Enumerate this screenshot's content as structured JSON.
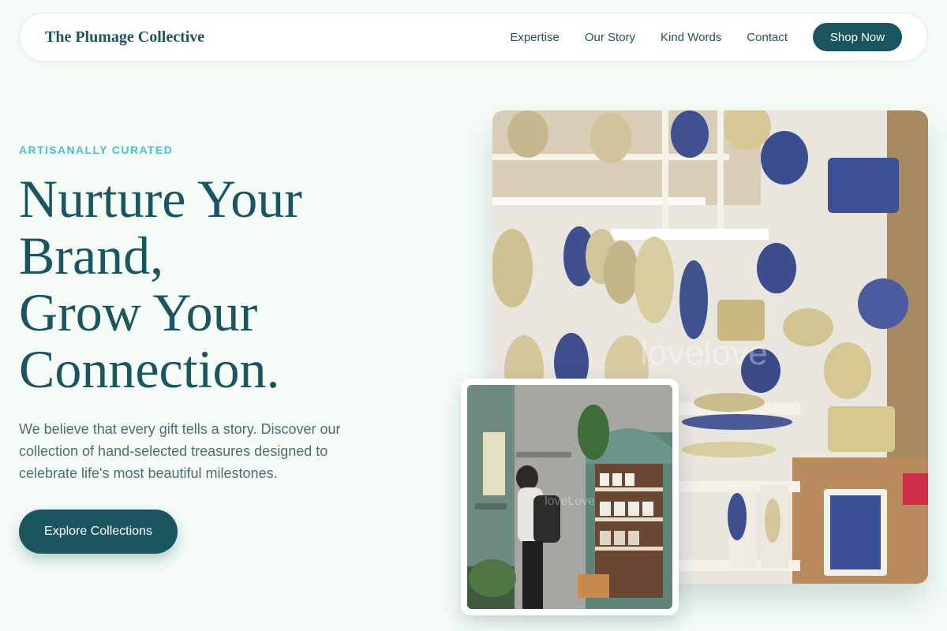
{
  "nav": {
    "brand": "The Plumage Collective",
    "links": [
      "Expertise",
      "Our Story",
      "Kind Words",
      "Contact"
    ],
    "shop_label": "Shop Now"
  },
  "hero": {
    "eyebrow": "ARTISANALLY CURATED",
    "headline_lines": [
      "Nurture Your",
      "Brand,",
      "Grow Your",
      "Connection."
    ],
    "lede": "We believe that every gift tells a story. Discover our collection of hand-selected treasures designed to celebrate life's most beautiful milestones.",
    "cta_label": "Explore Collections"
  },
  "images": {
    "main": "ceramics-shop-wall-photo",
    "secondary": "gift-shop-browsing-photo"
  },
  "colors": {
    "background": "#f5fcf7",
    "primary": "#1b5560",
    "accent": "#4fbfc2",
    "body_text": "#4d6d73"
  }
}
